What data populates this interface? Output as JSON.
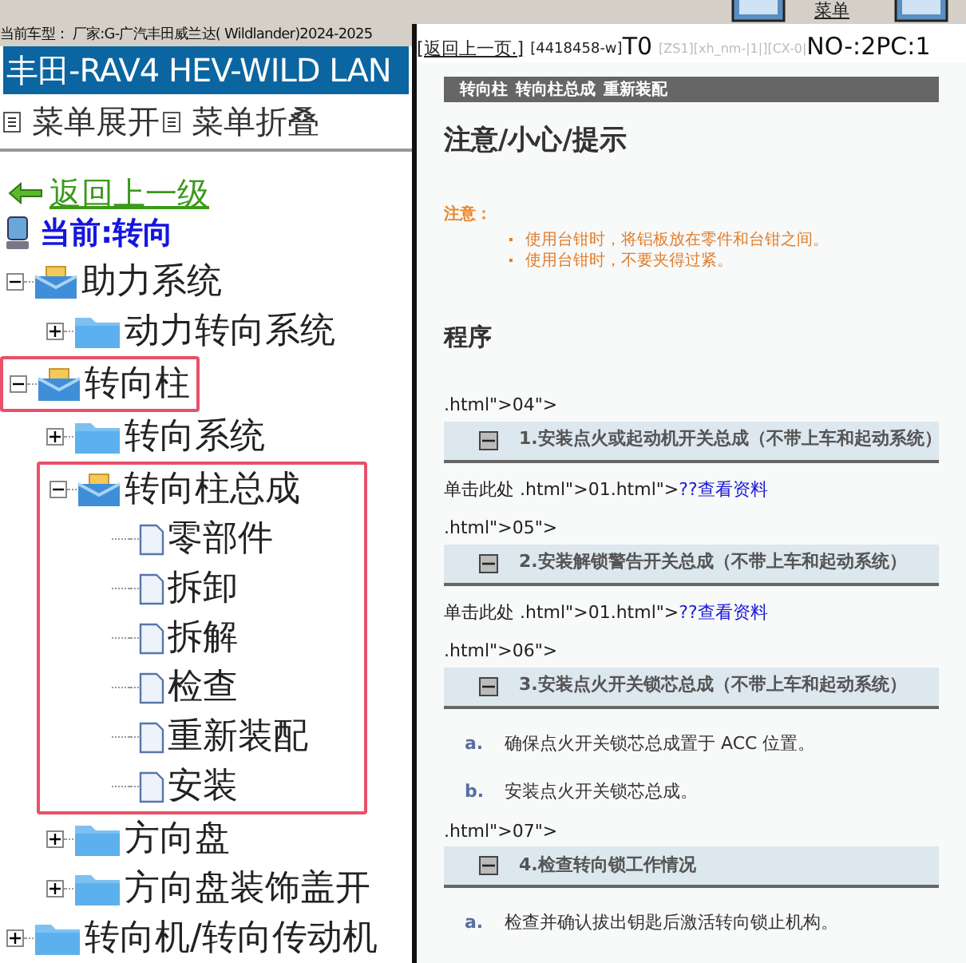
{
  "toolbar": {
    "menu_label": "菜单"
  },
  "left": {
    "car_model": "当前车型： 厂家:G-广汽丰田威兰达( Wildlander)2024-2025",
    "banner": "丰田-RAV4 HEV-WILD LAN",
    "menu_actions": [
      "菜单展开",
      "菜单折叠"
    ],
    "back_link": "返回上一级",
    "current": "当前:转向",
    "tree": [
      {
        "label": "助力系统",
        "kind": "open-folder",
        "expanded": true,
        "highlighted": false,
        "children": [
          {
            "label": "动力转向系统",
            "kind": "folder",
            "expanded": false,
            "highlighted": false
          }
        ]
      },
      {
        "label": "转向柱",
        "kind": "open-folder",
        "expanded": true,
        "highlighted": true,
        "children": [
          {
            "label": "转向系统",
            "kind": "folder",
            "expanded": false,
            "highlighted": false
          },
          {
            "label": "转向柱总成",
            "kind": "open-folder",
            "expanded": true,
            "highlighted": true,
            "children": [
              {
                "label": "零部件",
                "kind": "page",
                "highlighted": false
              },
              {
                "label": "拆卸",
                "kind": "page",
                "highlighted": false
              },
              {
                "label": "拆解",
                "kind": "page",
                "highlighted": false
              },
              {
                "label": "检查",
                "kind": "page",
                "highlighted": false
              },
              {
                "label": "重新装配",
                "kind": "page",
                "highlighted": false
              },
              {
                "label": "安装",
                "kind": "page",
                "highlighted": false
              }
            ]
          },
          {
            "label": "方向盘",
            "kind": "folder",
            "expanded": false,
            "highlighted": false
          },
          {
            "label": "方向盘装饰盖开",
            "kind": "folder",
            "expanded": false,
            "highlighted": false
          }
        ]
      },
      {
        "label": "转向机/转向传动机",
        "kind": "folder",
        "expanded": false,
        "highlighted": false
      }
    ]
  },
  "right": {
    "back_link": "[返回上一页.]",
    "doc_id": "[4418458-w]",
    "t_code": "T0",
    "params": "[ZS1][xh_nm-|1|][CX-0|",
    "page_code": "NO-:2PC:1",
    "breadcrumb": [
      "转向柱",
      "转向柱总成",
      "重新装配"
    ],
    "notice_heading": "注意/小心/提示",
    "caution_label": "注意：",
    "caution_items": [
      "使用台钳时，将铝板放在零件和台钳之间。",
      "使用台钳时，不要夹得过紧。"
    ],
    "procedure_heading": "程序",
    "blocks": [
      {
        "kind": "code",
        "text": ".html\">04\">"
      },
      {
        "kind": "step",
        "text": "1.安装点火或起动机开关总成（不带上车和起动系统）",
        "expanded": true
      },
      {
        "kind": "link-line",
        "text": "单击此处 .html\">01.html\">",
        "link": "??查看资料"
      },
      {
        "kind": "code",
        "text": ".html\">05\">"
      },
      {
        "kind": "step",
        "text": "2.安装解锁警告开关总成（不带上车和起动系统）",
        "expanded": true
      },
      {
        "kind": "link-line",
        "text": "单击此处 .html\">01.html\">",
        "link": "??查看资料"
      },
      {
        "kind": "code",
        "text": ".html\">06\">"
      },
      {
        "kind": "step",
        "text": "3.安装点火开关锁芯总成（不带上车和起动系统）",
        "expanded": true
      },
      {
        "kind": "substep",
        "letter": "a.",
        "text": "确保点火开关锁芯总成置于 ACC 位置。"
      },
      {
        "kind": "substep",
        "letter": "b.",
        "text": "安装点火开关锁芯总成。"
      },
      {
        "kind": "code",
        "text": ".html\">07\">"
      },
      {
        "kind": "step",
        "text": "4.检查转向锁工作情况",
        "expanded": true
      },
      {
        "kind": "substep",
        "letter": "a.",
        "text": "检查并确认拔出钥匙后激活转向锁止机构。"
      }
    ]
  }
}
